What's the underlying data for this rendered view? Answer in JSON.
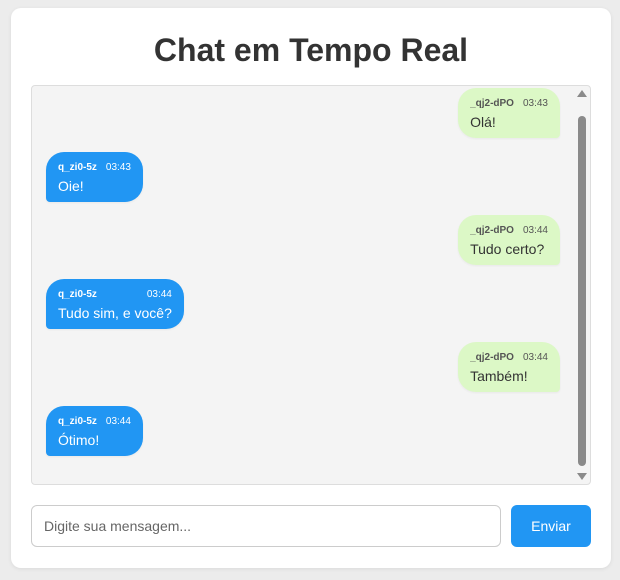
{
  "header": {
    "title": "Chat em Tempo Real"
  },
  "messages": [
    {
      "author": "_qj2-dPO",
      "time": "03:43",
      "text": "Olá!",
      "mine": true
    },
    {
      "author": "q_zi0-5z",
      "time": "03:43",
      "text": "Oie!",
      "mine": false
    },
    {
      "author": "_qj2-dPO",
      "time": "03:44",
      "text": "Tudo certo?",
      "mine": true
    },
    {
      "author": "q_zi0-5z",
      "time": "03:44",
      "text": "Tudo sim, e você?",
      "mine": false
    },
    {
      "author": "_qj2-dPO",
      "time": "03:44",
      "text": "Também!",
      "mine": true
    },
    {
      "author": "q_zi0-5z",
      "time": "03:44",
      "text": "Ótimo!",
      "mine": false
    }
  ],
  "composer": {
    "placeholder": "Digite sua mensagem...",
    "value": "",
    "send_label": "Enviar"
  },
  "colors": {
    "accent": "#2196f3",
    "own_bubble": "#dcf8c6"
  },
  "icons": {
    "scroll_up": "scroll-up-arrow-icon",
    "scroll_down": "scroll-down-arrow-icon"
  }
}
